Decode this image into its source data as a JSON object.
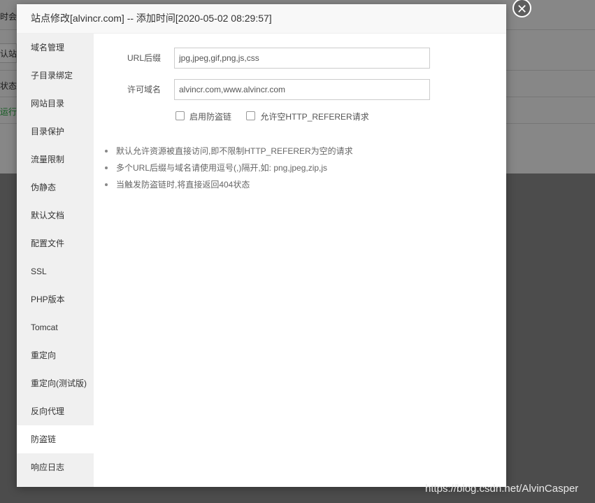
{
  "background": {
    "texts": [
      "时会",
      "认站",
      "状态",
      "运行"
    ]
  },
  "modal": {
    "title": "站点修改[alvincr.com] -- 添加时间[2020-05-02 08:29:57]",
    "close_glyph": "✕",
    "sidebar": {
      "items": [
        {
          "label": "域名管理"
        },
        {
          "label": "子目录绑定"
        },
        {
          "label": "网站目录"
        },
        {
          "label": "目录保护"
        },
        {
          "label": "流量限制"
        },
        {
          "label": "伪静态"
        },
        {
          "label": "默认文档"
        },
        {
          "label": "配置文件"
        },
        {
          "label": "SSL"
        },
        {
          "label": "PHP版本"
        },
        {
          "label": "Tomcat"
        },
        {
          "label": "重定向"
        },
        {
          "label": "重定向(测试版)"
        },
        {
          "label": "反向代理"
        },
        {
          "label": "防盗链"
        },
        {
          "label": "响应日志"
        }
      ],
      "active": "防盗链"
    },
    "form": {
      "url_suffix_label": "URL后缀",
      "url_suffix_value": "jpg,jpeg,gif,png,js,css",
      "domain_label": "许可域名",
      "domain_value": "alvincr.com,www.alvincr.com",
      "enable_label": "启用防盗链",
      "allow_empty_label": "允许空HTTP_REFERER请求"
    },
    "tips": [
      "默认允许资源被直接访问,即不限制HTTP_REFERER为空的请求",
      "多个URL后缀与域名请使用逗号(,)隔开,如: png,jpeg,zip,js",
      "当触发防盗链时,将直接返回404状态"
    ]
  },
  "watermark": "https://blog.csdn.net/AlvinCasper"
}
